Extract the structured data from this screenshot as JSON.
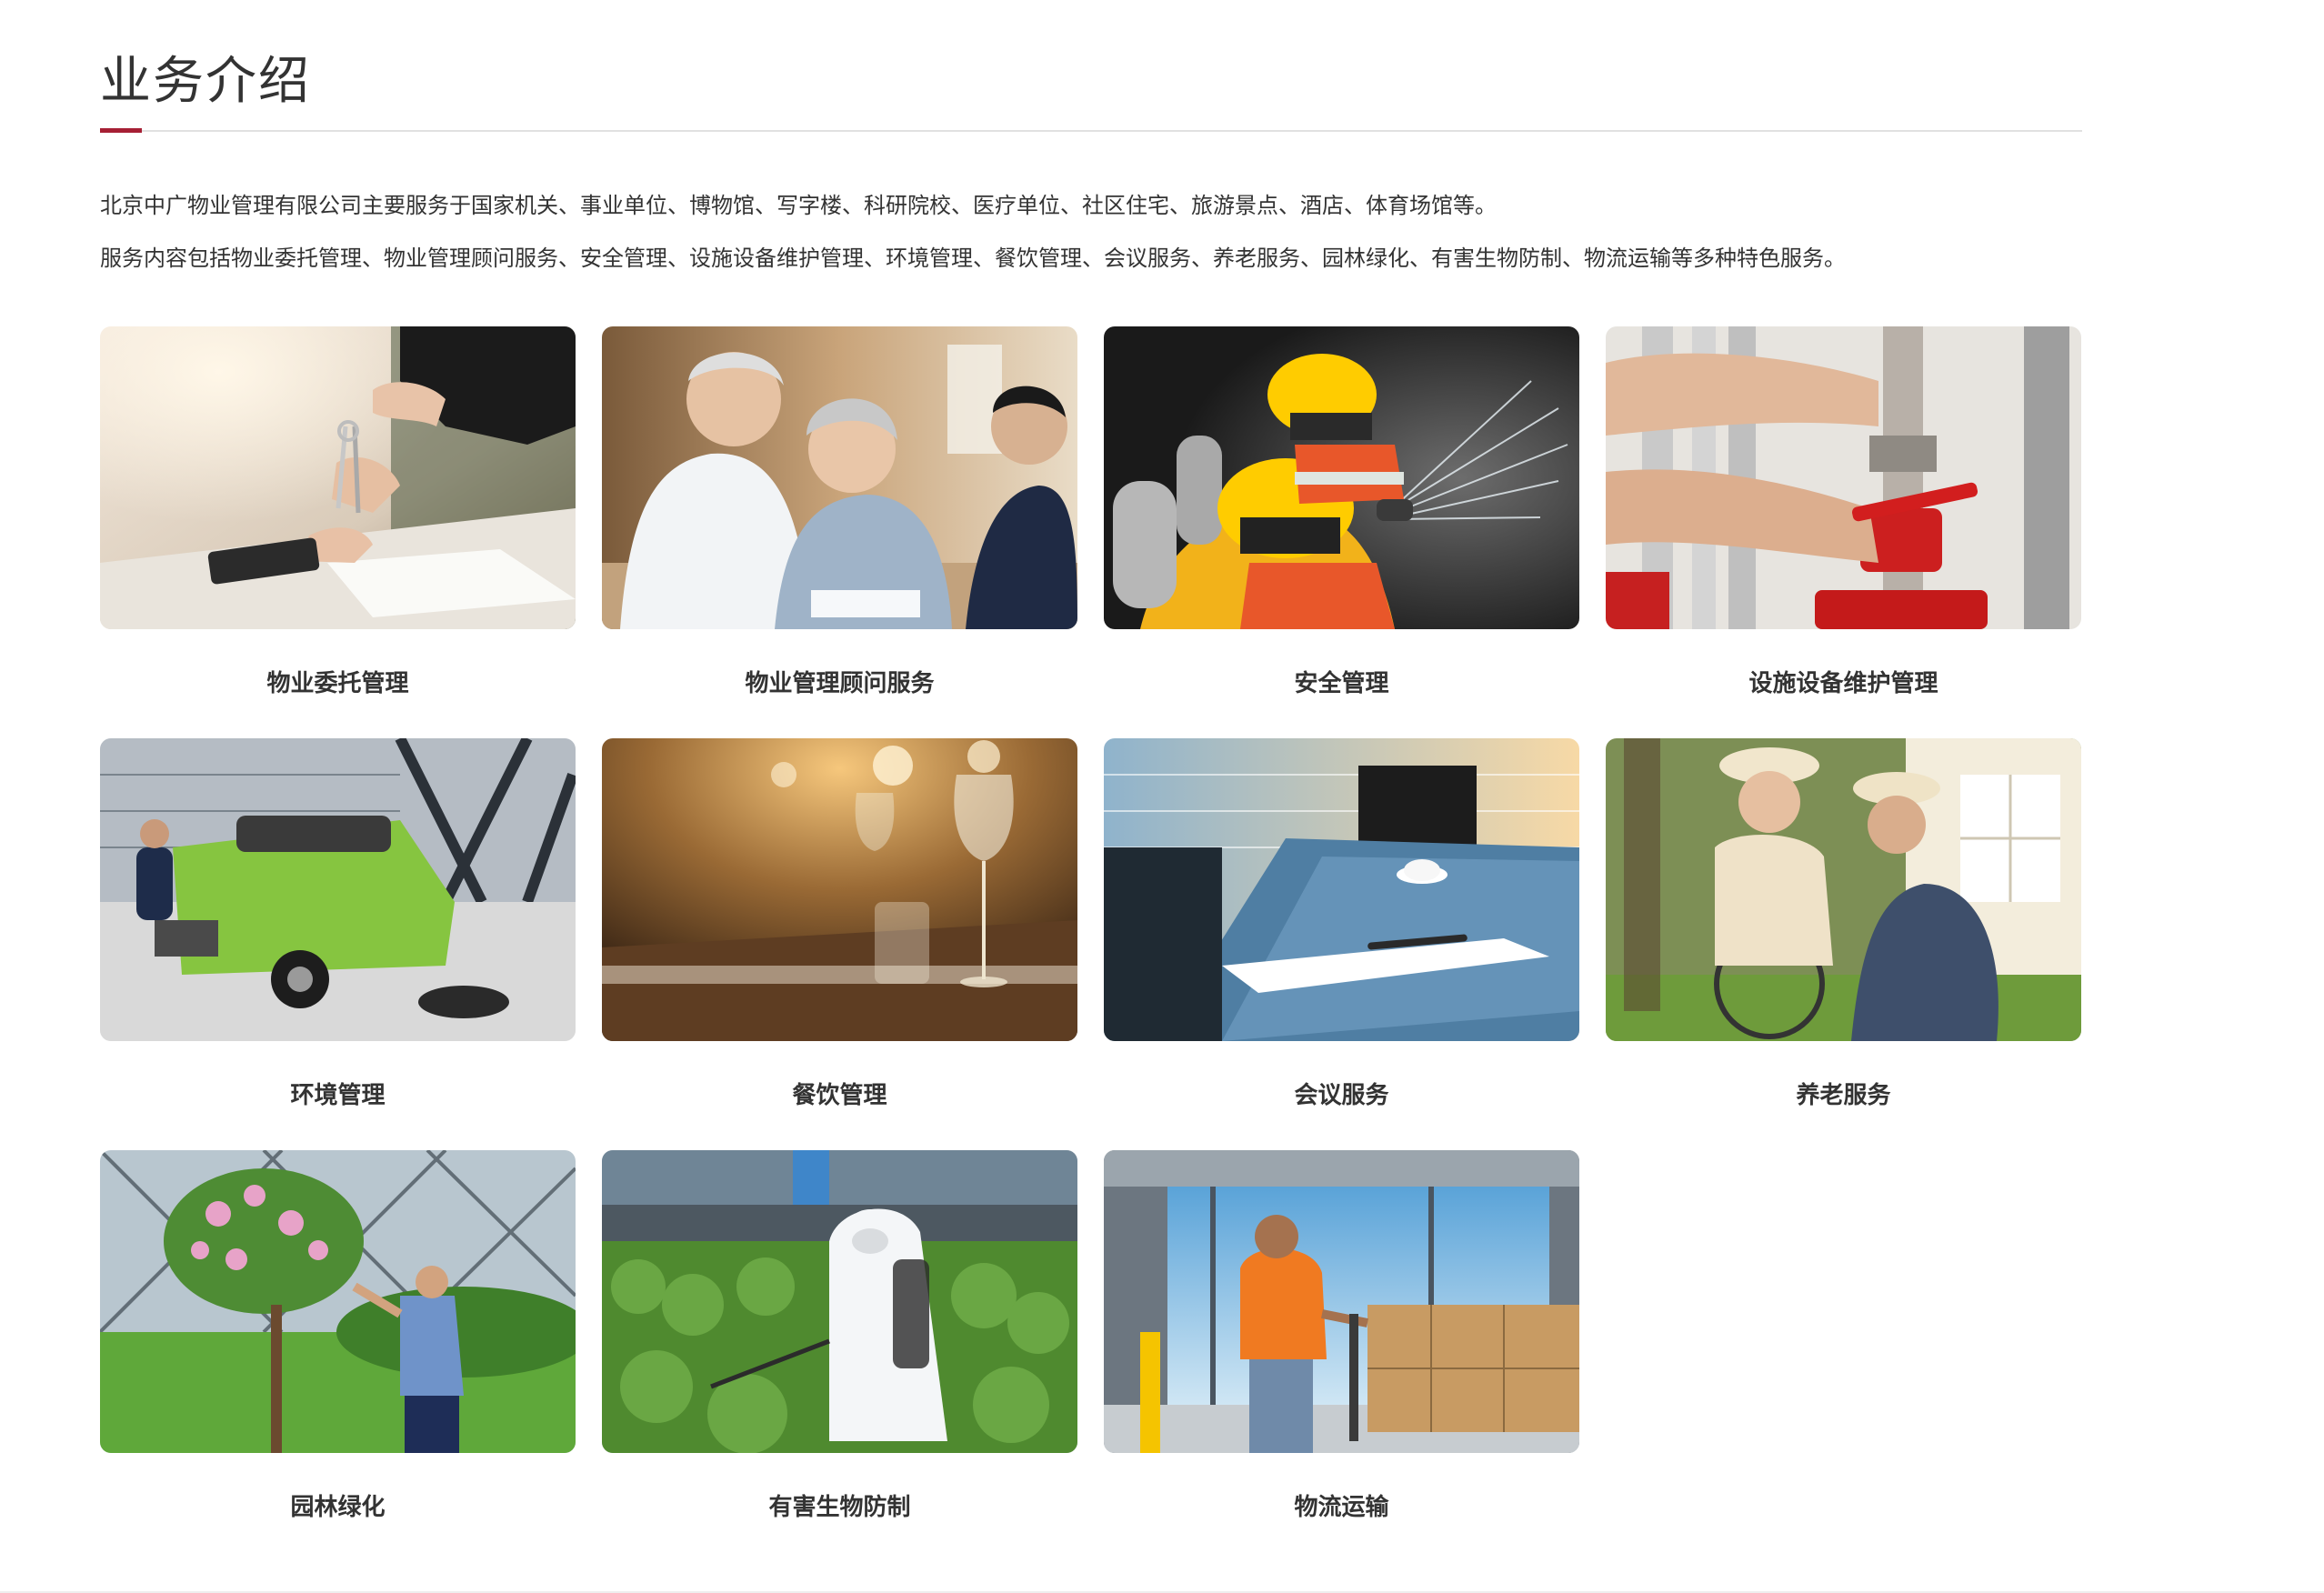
{
  "section": {
    "title": "业务介绍",
    "accent_color": "#a61f34",
    "intro_lines": [
      "北京中广物业管理有限公司主要服务于国家机关、事业单位、博物馆、写字楼、科研院校、医疗单位、社区住宅、旅游景点、酒店、体育场馆等。",
      "服务内容包括物业委托管理、物业管理顾问服务、安全管理、设施设备维护管理、环境管理、餐饮管理、会议服务、养老服务、园林绿化、有害生物防制、物流运输等多种特色服务。"
    ]
  },
  "services": [
    {
      "label": "物业委托管理",
      "image": "handing-over-keys-photo"
    },
    {
      "label": "物业管理顾问服务",
      "image": "elderly-couple-consultation-photo"
    },
    {
      "label": "安全管理",
      "image": "firefighters-spraying-water-photo"
    },
    {
      "label": "设施设备维护管理",
      "image": "pipe-valve-repair-photo"
    },
    {
      "label": "环境管理",
      "image": "street-sweeper-vehicle-photo"
    },
    {
      "label": "餐饮管理",
      "image": "restaurant-table-glasses-photo"
    },
    {
      "label": "会议服务",
      "image": "meeting-room-table-photo"
    },
    {
      "label": "养老服务",
      "image": "elderly-woman-wheelchair-photo"
    },
    {
      "label": "园林绿化",
      "image": "gardener-pruning-tree-photo"
    },
    {
      "label": "有害生物防制",
      "image": "pest-control-spraying-photo"
    },
    {
      "label": "物流运输",
      "image": "warehouse-pallet-jack-photo"
    }
  ]
}
